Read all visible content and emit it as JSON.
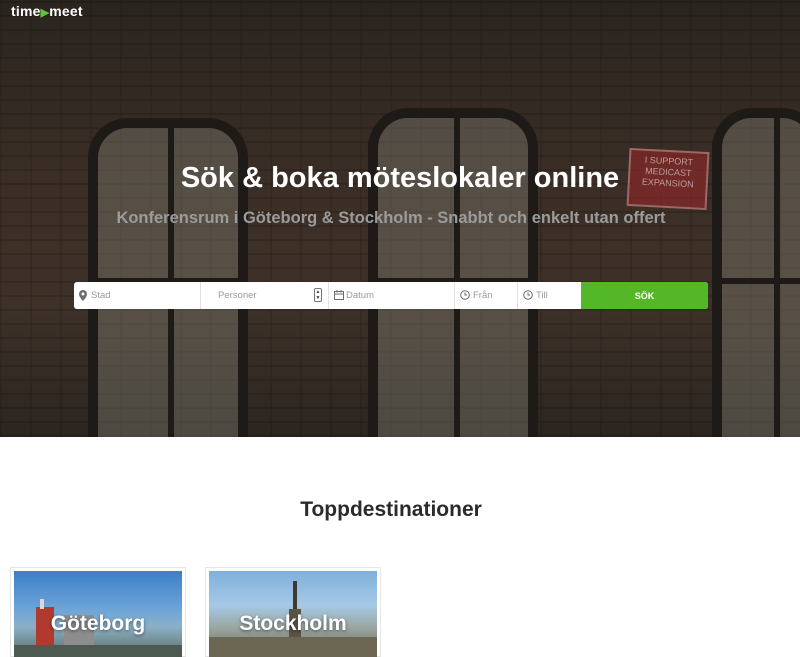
{
  "brand": {
    "logo_left": "time",
    "logo_arrow": "▶",
    "logo_right": "meet"
  },
  "hero": {
    "headline": "Sök & boka möteslokaler online",
    "subline": "Konferensrum i Göteborg & Stockholm - Snabbt och enkelt utan offert",
    "sign_text": "I SUPPORT MEDICAST EXPANSION"
  },
  "search": {
    "city_placeholder": "Stad",
    "persons_placeholder": "Personer",
    "date_placeholder": "Datum",
    "from_placeholder": "Från",
    "to_placeholder": "Till",
    "submit_label": "SÖK"
  },
  "destinations": {
    "title": "Toppdestinationer",
    "items": [
      {
        "name": "Göteborg"
      },
      {
        "name": "Stockholm"
      }
    ]
  },
  "colors": {
    "accent": "#53b727",
    "heading": "#2b2b2b",
    "subline": "#9b9b9b"
  },
  "icons": {
    "city": "map-pin-icon",
    "persons": "number-stepper-icon",
    "date": "calendar-icon",
    "from": "clock-icon",
    "to": "clock-icon"
  }
}
